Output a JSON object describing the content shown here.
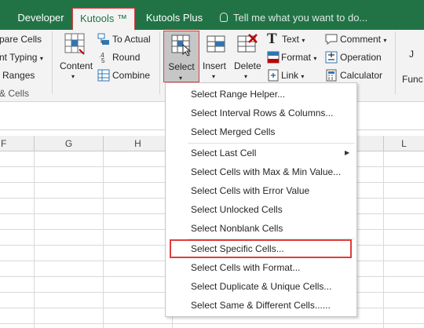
{
  "tabs": {
    "developer": "Developer",
    "kutools": "Kutools ™",
    "kutools_plus": "Kutools Plus",
    "tell_me": "Tell me what you want to do..."
  },
  "ribbon": {
    "left": {
      "compare_cells": "pare Cells",
      "print_typing": "nt Typing",
      "ranges": "Ranges",
      "group_label": "& Cells"
    },
    "content": "Content",
    "to_actual": "To Actual",
    "round": "Round",
    "combine": "Combine",
    "select": "Select",
    "insert": "Insert",
    "delete": "Delete",
    "text": "Text",
    "format": "Format",
    "link": "Link",
    "comment": "Comment",
    "operation": "Operation",
    "calculator": "Calculator",
    "right_cut": {
      "line1": "J",
      "line2": "Func"
    }
  },
  "columns": [
    "F",
    "G",
    "H",
    "L"
  ],
  "menu": {
    "items": [
      "Select Range Helper...",
      "Select Interval Rows & Columns...",
      "Select Merged Cells",
      "Select Last Cell",
      "Select Cells with Max & Min Value...",
      "Select Cells with Error Value",
      "Select Unlocked Cells",
      "Select Nonblank Cells",
      "Select Specific Cells...",
      "Select Cells with Format...",
      "Select Duplicate & Unique Cells...",
      "Select Same & Different Cells......"
    ],
    "highlighted": "Select Specific Cells..."
  },
  "colors": {
    "excel_green": "#217346",
    "highlight_red": "#e23c3c",
    "ribbon_bg": "#f3f3f3"
  }
}
